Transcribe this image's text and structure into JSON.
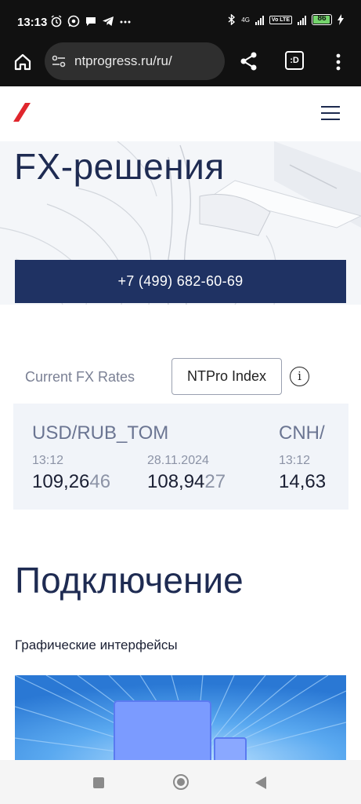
{
  "status_bar": {
    "time": "13:13",
    "notification_icons": [
      "alarm-icon",
      "whatsapp-icon",
      "chat-icon",
      "telegram-icon",
      "more-icon"
    ],
    "network_label": "4G",
    "volte_label": "Vo LTE",
    "battery_level": "86"
  },
  "browser": {
    "url": "ntprogress.ru/ru/",
    "tabs_label": ":D"
  },
  "hero": {
    "title": "FX-решения",
    "phone": "+7 (499) 682-60-69"
  },
  "rates": {
    "tabs": [
      {
        "label": "Current FX Rates",
        "active": false
      },
      {
        "label": "NTPro Index",
        "active": true
      }
    ],
    "items": [
      {
        "pair": "USD/RUB_TOM",
        "bid_time": "13:12",
        "bid_main": "109,26",
        "bid_tail": "46",
        "ask_time": "28.11.2024",
        "ask_main": "108,94",
        "ask_tail": "27"
      },
      {
        "pair": "CNH/",
        "bid_time": "13:12",
        "bid_main": "14,63",
        "bid_tail": ""
      }
    ]
  },
  "connection": {
    "title": "Подключение",
    "subtitle": "Графические интерфейсы"
  },
  "colors": {
    "brand_navy": "#1f3263",
    "brand_red": "#e0262d"
  }
}
